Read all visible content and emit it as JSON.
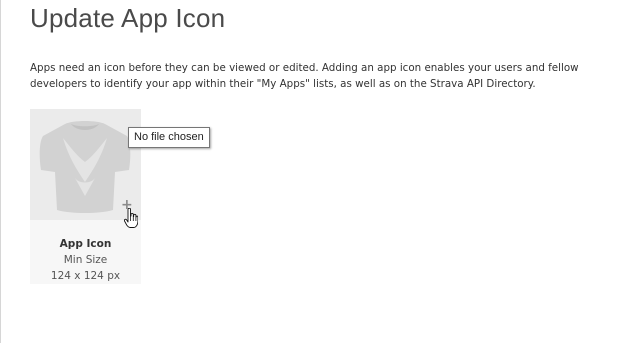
{
  "page": {
    "title": "Update App Icon",
    "description": "Apps need an icon before they can be viewed or edited. Adding an app icon enables your users and fellow developers to identify your app within their \"My Apps\" lists, as well as on the Strava API Directory."
  },
  "icon_upload": {
    "label": "App Icon",
    "min_size_label": "Min Size",
    "min_size_value": "124 x 124 px",
    "add_glyph": "+",
    "tooltip": "No file chosen",
    "placeholder_icon": "jersey-icon"
  },
  "colors": {
    "preview_bg": "#ebebeb",
    "card_bg": "#f7f7f7",
    "jersey_fill": "#d2d2d2"
  }
}
